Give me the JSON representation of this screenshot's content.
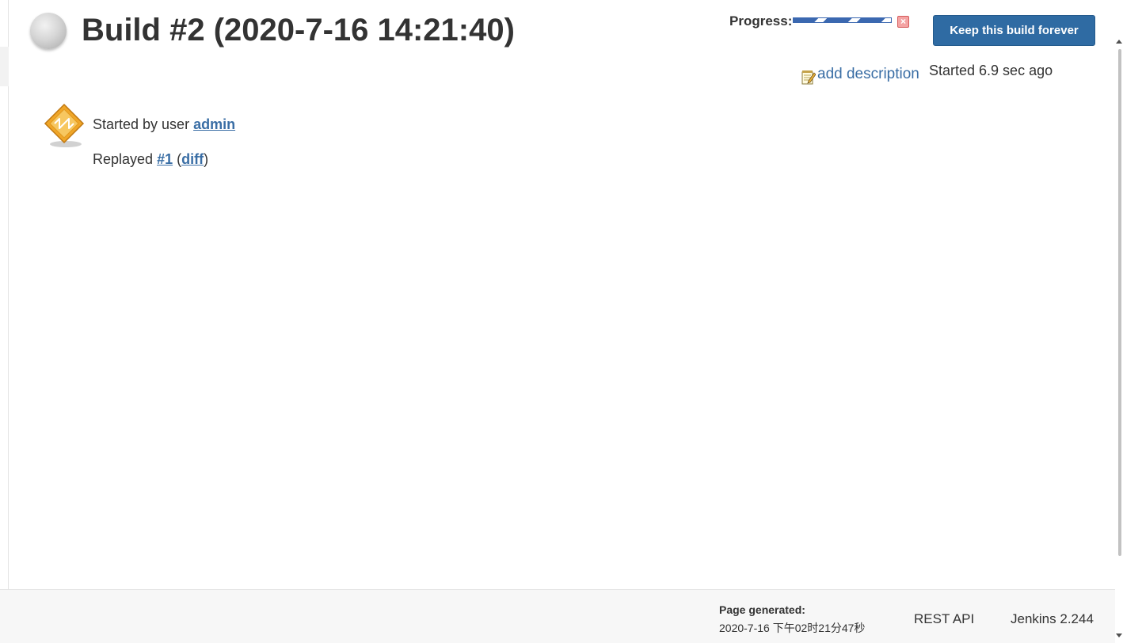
{
  "header": {
    "title": "Build #2 (2020-7-16 14:21:40)",
    "status_icon": "grey-ball-icon",
    "progress_label": "Progress:",
    "stop_icon": "stop-x-icon",
    "keep_button_label": "Keep this build forever"
  },
  "description": {
    "add_label": "add description",
    "icon": "notepad-icon",
    "started_ago": "Started 6.9 sec ago"
  },
  "cause": {
    "icon": "user-cause-icon",
    "started_by_prefix": "Started by user ",
    "user": "admin",
    "replayed_prefix": "Replayed ",
    "replayed_build": "#1",
    "open_paren": " (",
    "diff_label": "diff",
    "close_paren": ")"
  },
  "footer": {
    "page_generated_label": "Page generated:",
    "page_generated_value": "2020-7-16 下午02时21分47秒",
    "rest_api_label": "REST API",
    "version_label": "Jenkins 2.244"
  },
  "colors": {
    "link": "#3a6ea5",
    "button": "#2f6ba3",
    "progress": "#3b68b0"
  }
}
